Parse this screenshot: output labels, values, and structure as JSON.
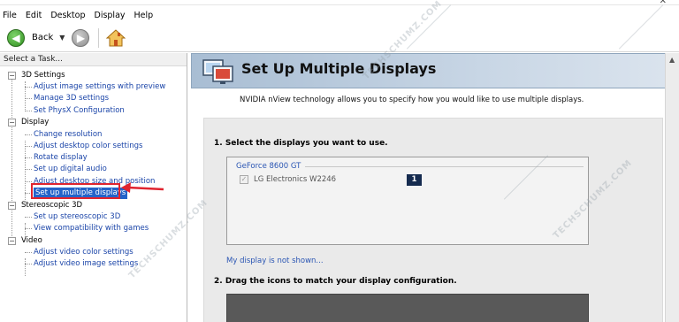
{
  "menu": [
    "File",
    "Edit",
    "Desktop",
    "Display",
    "Help"
  ],
  "window": {
    "close_glyph": "✕"
  },
  "toolbar": {
    "back_label": "Back"
  },
  "left": {
    "task_header": "Select a Task...",
    "tree": [
      {
        "label": "3D Settings",
        "items": [
          "Adjust image settings with preview",
          "Manage 3D settings",
          "Set PhysX Configuration"
        ]
      },
      {
        "label": "Display",
        "items": [
          "Change resolution",
          "Adjust desktop color settings",
          "Rotate display",
          "Set up digital audio",
          "Adjust desktop size and position",
          "Set up multiple displays"
        ]
      },
      {
        "label": "Stereoscopic 3D",
        "items": [
          "Set up stereoscopic 3D",
          "View compatibility with games"
        ]
      },
      {
        "label": "Video",
        "items": [
          "Adjust video color settings",
          "Adjust video image settings"
        ]
      }
    ],
    "selected": "Set up multiple displays"
  },
  "right": {
    "title": "Set Up Multiple Displays",
    "description": "NVIDIA nView technology allows you to specify how you would like to use multiple displays.",
    "section1": "1. Select the displays you want to use.",
    "gpu": "GeForce 8600 GT",
    "monitor": {
      "name": "LG Electronics W2246",
      "number": "1",
      "checked": true
    },
    "not_shown_link": "My display is not shown...",
    "section2": "2. Drag the icons to match your display configuration."
  },
  "watermark": "TECHSCHUMZ.COM",
  "colors": {
    "selection": "#2463c9",
    "highlight_box": "#e0242f",
    "link": "#2a55b3",
    "banner": "#a8bdd3"
  },
  "icons": [
    "back-arrow-icon",
    "forward-arrow-icon",
    "home-icon",
    "nview-display-icon",
    "checkbox-icon",
    "red-arrow-icon"
  ]
}
